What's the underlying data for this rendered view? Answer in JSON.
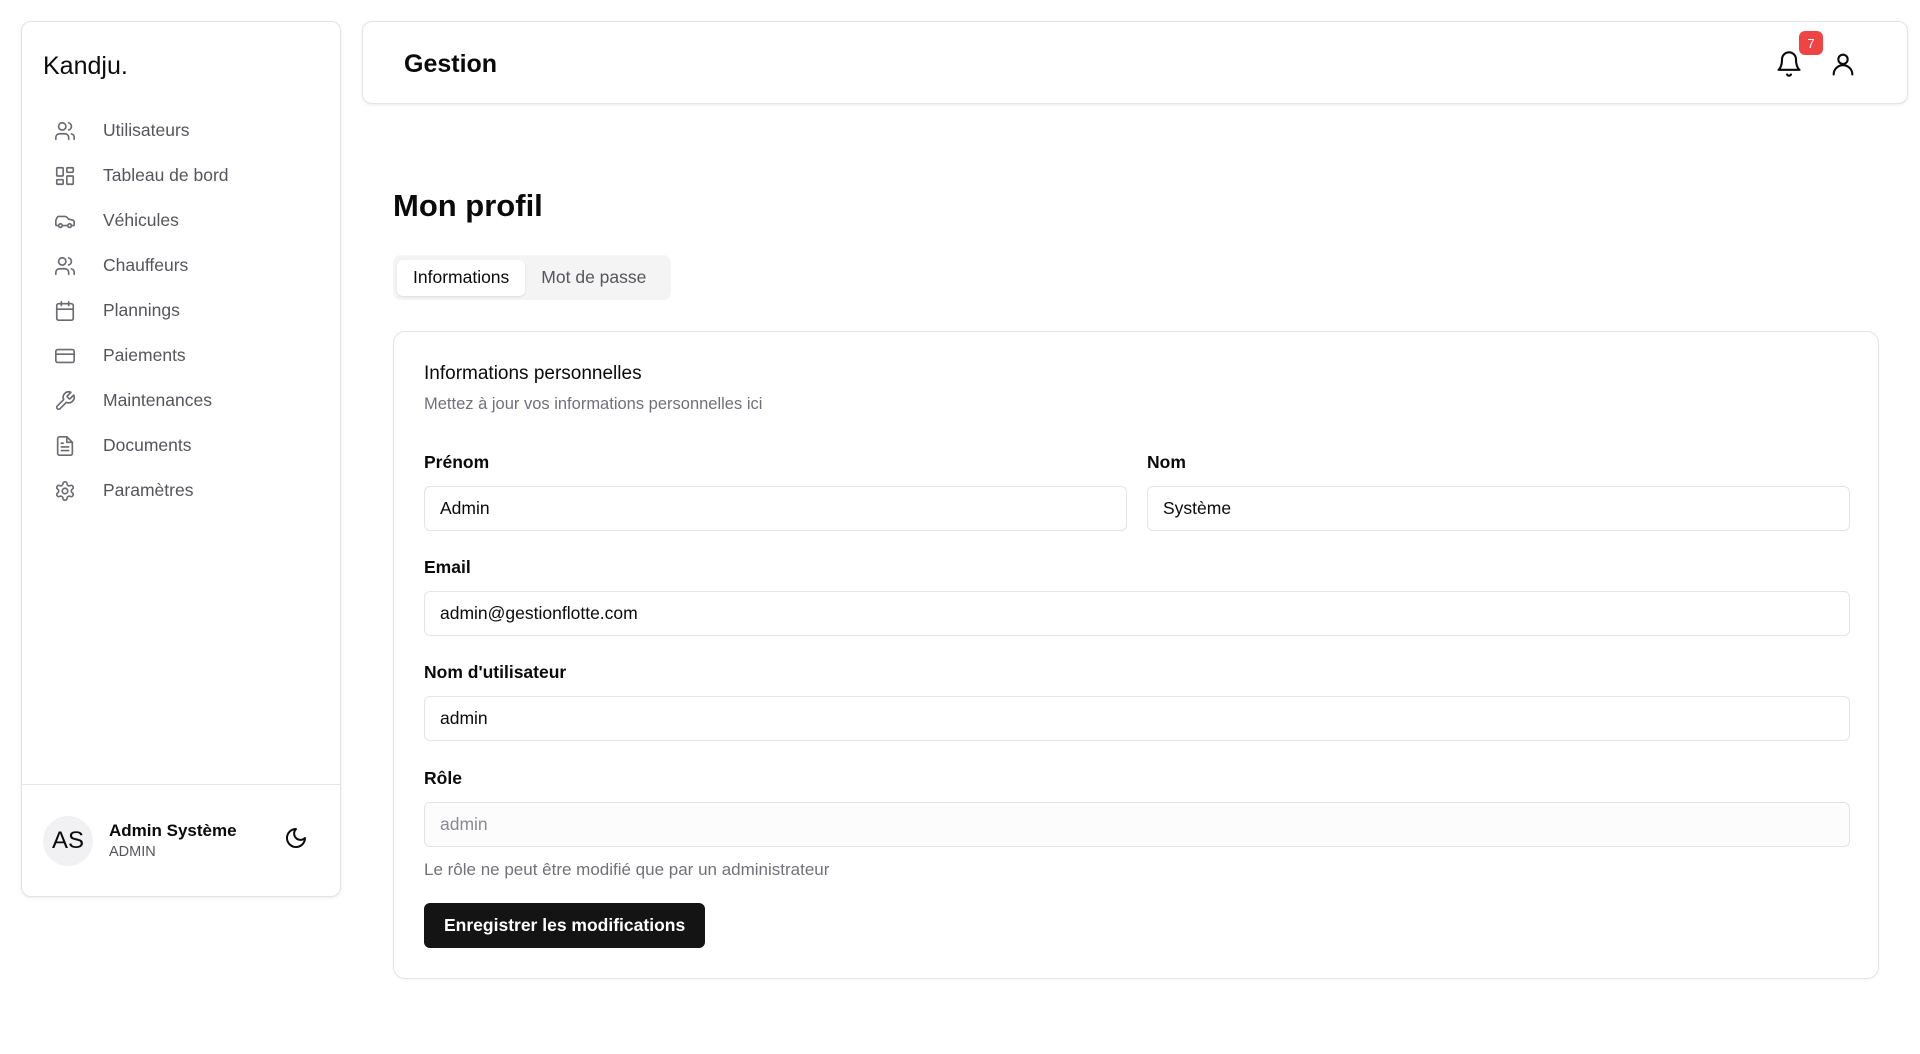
{
  "app": {
    "brand": "Kandju."
  },
  "sidebar": {
    "items": [
      {
        "label": "Utilisateurs",
        "icon": "users-icon"
      },
      {
        "label": "Tableau de bord",
        "icon": "dashboard-icon"
      },
      {
        "label": "Véhicules",
        "icon": "car-icon"
      },
      {
        "label": "Chauffeurs",
        "icon": "users-icon"
      },
      {
        "label": "Plannings",
        "icon": "calendar-icon"
      },
      {
        "label": "Paiements",
        "icon": "credit-card-icon"
      },
      {
        "label": "Maintenances",
        "icon": "wrench-icon"
      },
      {
        "label": "Documents",
        "icon": "file-text-icon"
      },
      {
        "label": "Paramètres",
        "icon": "gear-icon"
      }
    ],
    "user": {
      "initials": "AS",
      "name": "Admin Système",
      "role": "ADMIN"
    }
  },
  "header": {
    "title": "Gestion",
    "notification_count": "7"
  },
  "page": {
    "title": "Mon profil",
    "tabs": [
      {
        "label": "Informations",
        "active": true
      },
      {
        "label": "Mot de passe",
        "active": false
      }
    ],
    "card": {
      "title": "Informations personnelles",
      "description": "Mettez à jour vos informations personnelles ici",
      "fields": {
        "first_name": {
          "label": "Prénom",
          "value": "Admin"
        },
        "last_name": {
          "label": "Nom",
          "value": "Système"
        },
        "email": {
          "label": "Email",
          "value": "admin@gestionflotte.com"
        },
        "username": {
          "label": "Nom d'utilisateur",
          "value": "admin"
        },
        "role": {
          "label": "Rôle",
          "value": "admin"
        }
      },
      "role_hint": "Le rôle ne peut être modifié que par un administrateur",
      "save_label": "Enregistrer les modifications"
    }
  },
  "colors": {
    "accent": "#141414",
    "badge": "#ef4444",
    "border": "#e4e4e7",
    "muted_text": "#71717a"
  }
}
